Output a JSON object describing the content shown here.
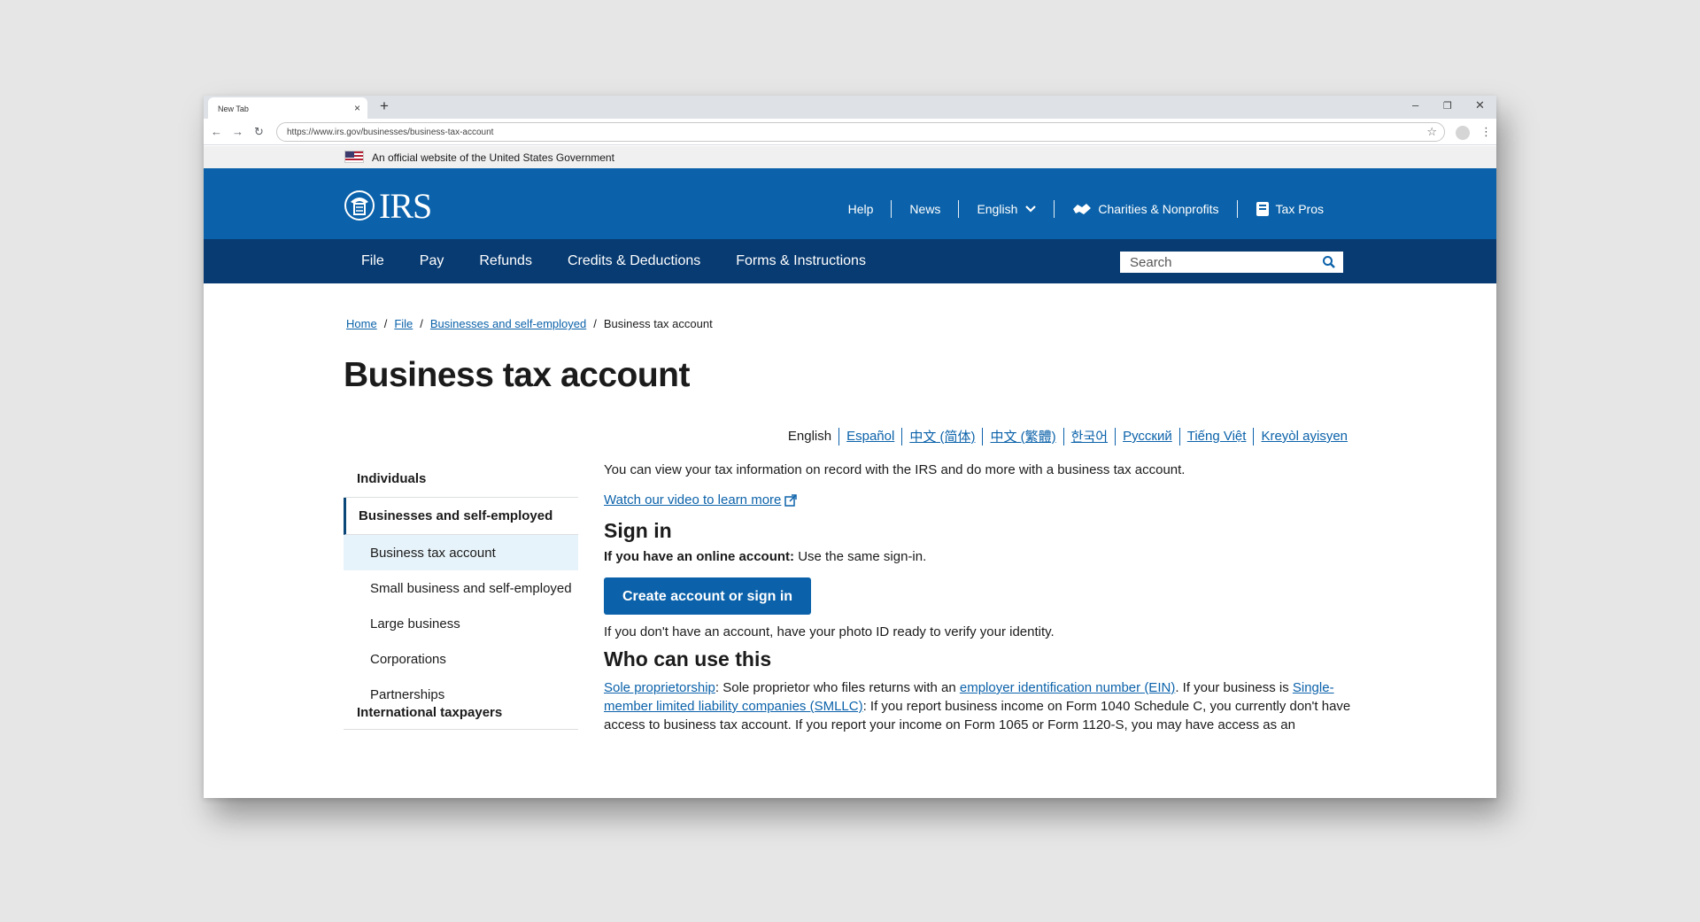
{
  "browser": {
    "tab_title": "New Tab",
    "url": "https://www.irs.gov/businesses/business-tax-account"
  },
  "gov_banner": {
    "text": "An official website of the United States Government"
  },
  "header": {
    "logo_text": "IRS",
    "links": {
      "help": "Help",
      "news": "News",
      "language": "English",
      "charities": "Charities & Nonprofits",
      "taxpros": "Tax Pros"
    }
  },
  "mainnav": {
    "items": [
      "File",
      "Pay",
      "Refunds",
      "Credits & Deductions",
      "Forms & Instructions"
    ],
    "search_placeholder": "Search"
  },
  "breadcrumb": [
    "Home",
    "File",
    "Businesses and self-employed",
    "Business tax account"
  ],
  "page_title": "Business tax account",
  "languages": [
    "English",
    "Español",
    "中文 (简体)",
    "中文 (繁體)",
    "한국어",
    "Русский",
    "Tiếng Việt",
    "Kreyòl ayisyen"
  ],
  "sidenav": {
    "top": "Individuals",
    "active": "Businesses and self-employed",
    "sub_items": [
      "Business tax account",
      "Small business and self-employed",
      "Large business",
      "Corporations",
      "Partnerships"
    ],
    "after": "International taxpayers"
  },
  "main": {
    "intro": "You can view your tax information on record with the IRS and do more with a business tax account.",
    "video_link": "Watch our video to learn more",
    "signin_heading": "Sign in",
    "account_bold": "If you have an online account:",
    "account_rest": " Use the same sign-in.",
    "cta": "Create account or sign in",
    "no_account": "If you don't have an account, have your photo ID ready to verify your identity.",
    "who_heading": "Who can use this",
    "who_link1": "Sole proprietorship",
    "who_text1": ": Sole proprietor who files returns with an ",
    "who_link2": "employer identification number (EIN)",
    "who_text2": ". If your business is ",
    "who_link3": "Single-member limited liability companies (SMLLC)",
    "who_text3": ": If you report business income on Form 1040 Schedule C, you currently don't have access to business tax account. If you report your income on Form 1065 or Form 1120-S, you may have access as an"
  }
}
